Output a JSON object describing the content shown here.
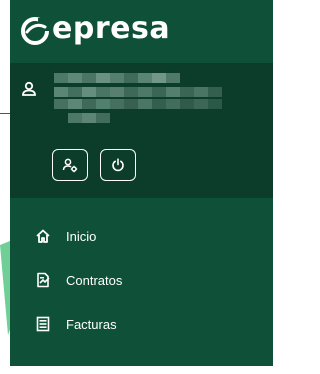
{
  "app": {
    "logo_text": "epresa",
    "logo_icon": "epresa-logo-icon"
  },
  "user": {
    "icon": "user-icon",
    "name_redacted": true,
    "actions": [
      {
        "icon": "user-settings-icon"
      },
      {
        "icon": "power-icon"
      }
    ]
  },
  "nav": {
    "items": [
      {
        "label": "Inicio",
        "icon": "home-icon"
      },
      {
        "label": "Contratos",
        "icon": "contract-sign-icon"
      },
      {
        "label": "Facturas",
        "icon": "invoice-list-icon"
      }
    ]
  },
  "colors": {
    "sidebar": "#0f5138",
    "user_panel": "#0b3d2a",
    "accent": "#6fcf97",
    "text": "#ffffff"
  }
}
